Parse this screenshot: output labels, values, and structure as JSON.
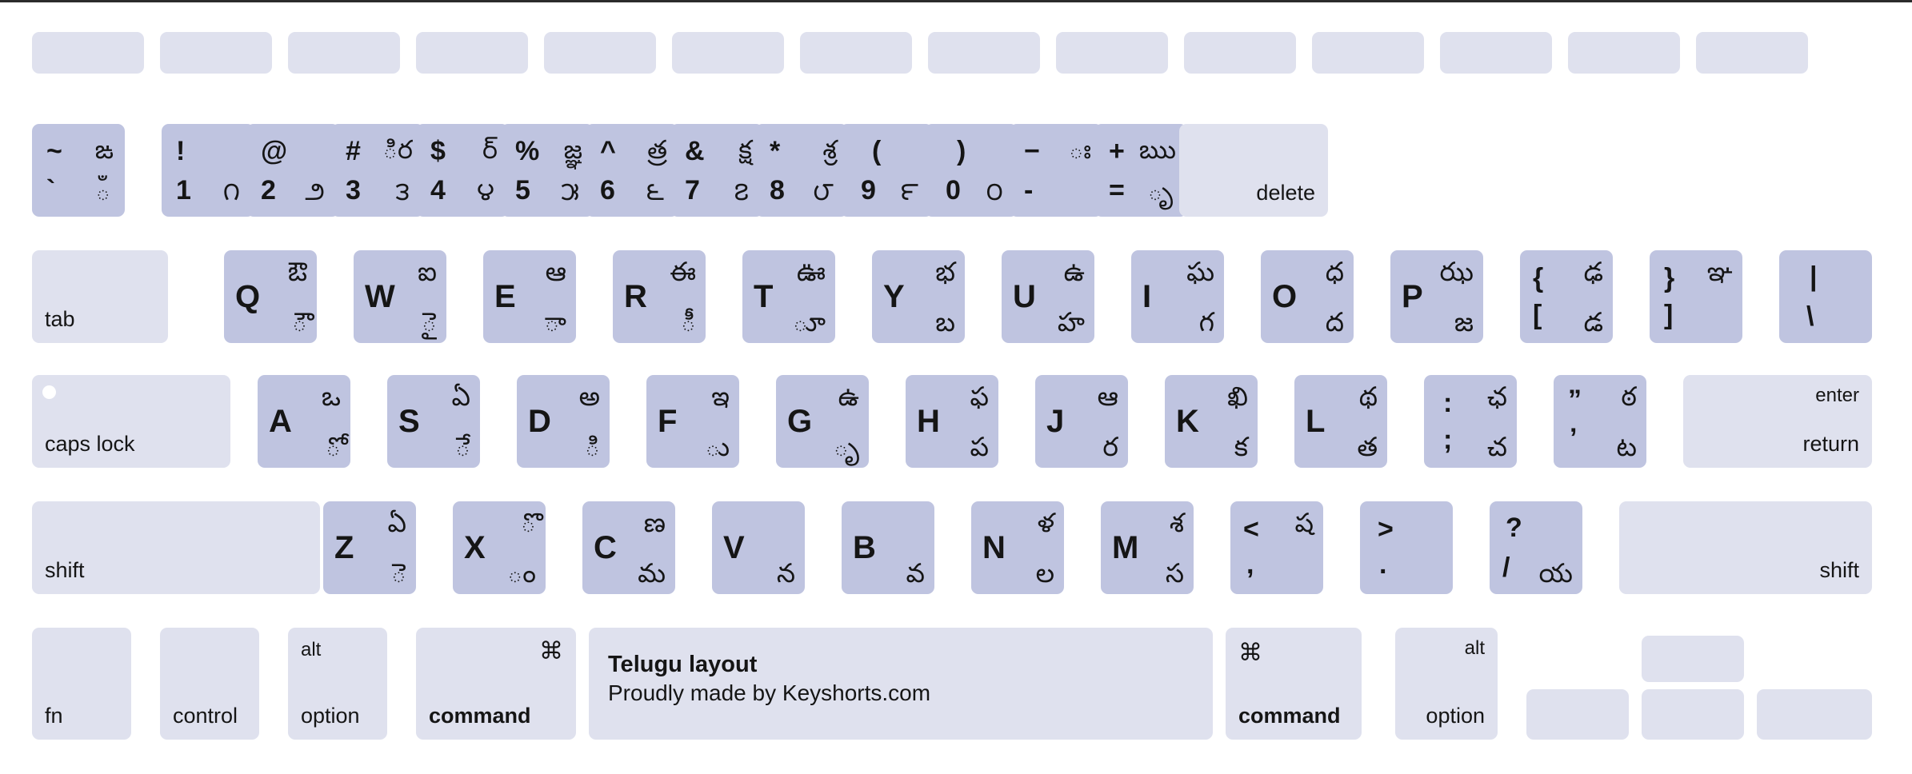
{
  "meta": {
    "layout_name": "Telugu layout",
    "colors": {
      "key_modifier": "#dfe1ee",
      "key_alpha": "#bfc4e0",
      "text": "#151515",
      "background": "#ffffff"
    }
  },
  "brand": {
    "title": "Telugu layout",
    "subtitle": "Proudly made by Keyshorts.com"
  },
  "rows": {
    "function_row": [
      {
        "name": "key-esc",
        "label": ""
      },
      {
        "name": "key-f1",
        "label": ""
      },
      {
        "name": "key-f2",
        "label": ""
      },
      {
        "name": "key-f3",
        "label": ""
      },
      {
        "name": "key-f4",
        "label": ""
      },
      {
        "name": "key-f5",
        "label": ""
      },
      {
        "name": "key-f6",
        "label": ""
      },
      {
        "name": "key-f7",
        "label": ""
      },
      {
        "name": "key-f8",
        "label": ""
      },
      {
        "name": "key-f9",
        "label": ""
      },
      {
        "name": "key-f10",
        "label": ""
      },
      {
        "name": "key-f11",
        "label": ""
      },
      {
        "name": "key-f12",
        "label": ""
      },
      {
        "name": "key-power",
        "label": ""
      }
    ],
    "number_row": [
      {
        "name": "key-grave",
        "sym_top": "~",
        "sym_bot": "`",
        "tel_top": "ఙ",
        "tel_bot": "ఀ"
      },
      {
        "name": "key-1",
        "sym_top": "!",
        "sym_bot": "1",
        "tel_top": "",
        "tel_bot": "౧"
      },
      {
        "name": "key-2",
        "sym_top": "@",
        "sym_bot": "2",
        "tel_top": "",
        "tel_bot": "౨"
      },
      {
        "name": "key-3",
        "sym_top": "#",
        "sym_bot": "3",
        "tel_top": "ిర",
        "tel_bot": "౩"
      },
      {
        "name": "key-4",
        "sym_top": "$",
        "sym_bot": "4",
        "tel_top": "ర్",
        "tel_bot": "౪"
      },
      {
        "name": "key-5",
        "sym_top": "%",
        "sym_bot": "5",
        "tel_top": "జ్ఞ",
        "tel_bot": "౫"
      },
      {
        "name": "key-6",
        "sym_top": "^",
        "sym_bot": "6",
        "tel_top": "త్ర",
        "tel_bot": "౬"
      },
      {
        "name": "key-7",
        "sym_top": "&",
        "sym_bot": "7",
        "tel_top": "క్ష",
        "tel_bot": "౭"
      },
      {
        "name": "key-8",
        "sym_top": "*",
        "sym_bot": "8",
        "tel_top": "శ్ర",
        "tel_bot": "౮"
      },
      {
        "name": "key-9",
        "sym_top": "(",
        "sym_bot": "9",
        "tel_top": "",
        "tel_bot": "౯"
      },
      {
        "name": "key-0",
        "sym_top": ")",
        "sym_bot": "0",
        "tel_top": "",
        "tel_bot": "౦"
      },
      {
        "name": "key-minus",
        "sym_top": "−",
        "sym_bot": "-",
        "tel_top": "ః",
        "tel_bot": ""
      },
      {
        "name": "key-equal",
        "sym_top": "+",
        "sym_bot": "=",
        "tel_top": "ఋ",
        "tel_bot": "ృ"
      },
      {
        "name": "key-delete",
        "label": "delete"
      }
    ],
    "top_row": [
      {
        "name": "key-tab",
        "label": "tab"
      },
      {
        "name": "key-q",
        "latin": "Q",
        "tel_top": "ఔ",
        "tel_bot": "ౌ"
      },
      {
        "name": "key-w",
        "latin": "W",
        "tel_top": "ఐ",
        "tel_bot": "ై"
      },
      {
        "name": "key-e",
        "latin": "E",
        "tel_top": "ఆ",
        "tel_bot": "ా"
      },
      {
        "name": "key-r",
        "latin": "R",
        "tel_top": "ఈ",
        "tel_bot": "ీ"
      },
      {
        "name": "key-t",
        "latin": "T",
        "tel_top": "ఊ",
        "tel_bot": "ూ"
      },
      {
        "name": "key-y",
        "latin": "Y",
        "tel_top": "భ",
        "tel_bot": "బ"
      },
      {
        "name": "key-u",
        "latin": "U",
        "tel_top": "ఉ",
        "tel_bot": "హ"
      },
      {
        "name": "key-i",
        "latin": "I",
        "tel_top": "ఘ",
        "tel_bot": "గ"
      },
      {
        "name": "key-o",
        "latin": "O",
        "tel_top": "ధ",
        "tel_bot": "ద"
      },
      {
        "name": "key-p",
        "latin": "P",
        "tel_top": "ఝ",
        "tel_bot": "జ"
      },
      {
        "name": "key-bracketleft",
        "sym_top": "{",
        "sym_bot": "[",
        "tel_top": "ఢ",
        "tel_bot": "డ"
      },
      {
        "name": "key-bracketright",
        "sym_top": "}",
        "sym_bot": "]",
        "tel_top": "ఞ",
        "tel_bot": ""
      },
      {
        "name": "key-backslash",
        "sym_top": "|",
        "sym_bot": "\\",
        "tel_top": "",
        "tel_bot": ""
      }
    ],
    "home_row": [
      {
        "name": "key-capslock",
        "label": "caps lock"
      },
      {
        "name": "key-a",
        "latin": "A",
        "tel_top": "ఒ",
        "tel_bot": "ో"
      },
      {
        "name": "key-s",
        "latin": "S",
        "tel_top": "ఏ",
        "tel_bot": "ే"
      },
      {
        "name": "key-d",
        "latin": "D",
        "tel_top": "అ",
        "tel_bot": "ి"
      },
      {
        "name": "key-f",
        "latin": "F",
        "tel_top": "ఇ",
        "tel_bot": "ు"
      },
      {
        "name": "key-g",
        "latin": "G",
        "tel_top": "ఉ",
        "tel_bot": "ృ"
      },
      {
        "name": "key-h",
        "latin": "H",
        "tel_top": "ఫ",
        "tel_bot": "ప"
      },
      {
        "name": "key-j",
        "latin": "J",
        "tel_top": "ఆ",
        "tel_bot": "ర"
      },
      {
        "name": "key-k",
        "latin": "K",
        "tel_top": "ఖి",
        "tel_bot": "క"
      },
      {
        "name": "key-l",
        "latin": "L",
        "tel_top": "థ",
        "tel_bot": "త"
      },
      {
        "name": "key-semicolon",
        "sym_top": ":",
        "sym_bot": ";",
        "tel_top": "ఛ",
        "tel_bot": "చ"
      },
      {
        "name": "key-quote",
        "sym_top": "”",
        "sym_bot": "’",
        "tel_top": "ఠ",
        "tel_bot": "ట"
      },
      {
        "name": "key-return",
        "label_top": "enter",
        "label_bottom": "return"
      }
    ],
    "bottom_letter_row": [
      {
        "name": "key-shift-left",
        "label": "shift"
      },
      {
        "name": "key-z",
        "latin": "Z",
        "tel_top": "ఏ",
        "tel_bot": "ె"
      },
      {
        "name": "key-x",
        "latin": "X",
        "tel_top": "ొ",
        "tel_bot": "ం"
      },
      {
        "name": "key-c",
        "latin": "C",
        "tel_top": "ణ",
        "tel_bot": "మ"
      },
      {
        "name": "key-v",
        "latin": "V",
        "tel_top": "",
        "tel_bot": "న"
      },
      {
        "name": "key-b",
        "latin": "B",
        "tel_top": "",
        "tel_bot": "వ"
      },
      {
        "name": "key-n",
        "latin": "N",
        "tel_top": "ళ",
        "tel_bot": "ల"
      },
      {
        "name": "key-m",
        "latin": "M",
        "tel_top": "శ",
        "tel_bot": "స"
      },
      {
        "name": "key-comma",
        "sym_top": "<",
        "sym_bot": ",",
        "tel_top": "ష",
        "tel_bot": ""
      },
      {
        "name": "key-period",
        "sym_top": ">",
        "sym_bot": ".",
        "tel_top": "",
        "tel_bot": ""
      },
      {
        "name": "key-slash",
        "sym_top": "?",
        "sym_bot": "/",
        "tel_top": "",
        "tel_bot": "య"
      },
      {
        "name": "key-shift-right",
        "label": "shift"
      }
    ],
    "modifier_row": [
      {
        "name": "key-fn",
        "label_bottom": "fn",
        "label_top": ""
      },
      {
        "name": "key-control",
        "label_bottom": "control",
        "label_top": ""
      },
      {
        "name": "key-option-left",
        "label_bottom": "option",
        "label_top": "alt"
      },
      {
        "name": "key-command-left",
        "label_bottom": "command",
        "label_top": "⌘"
      },
      {
        "name": "key-space",
        "label_bottom": "",
        "label_top": ""
      },
      {
        "name": "key-command-right",
        "label_bottom": "command",
        "label_top": "⌘"
      },
      {
        "name": "key-option-right",
        "label_bottom": "option",
        "label_top": "alt"
      },
      {
        "name": "key-arrow-left",
        "label_bottom": "",
        "label_top": ""
      },
      {
        "name": "key-arrow-up",
        "label_bottom": "",
        "label_top": ""
      },
      {
        "name": "key-arrow-down",
        "label_bottom": "",
        "label_top": ""
      },
      {
        "name": "key-arrow-right",
        "label_bottom": "",
        "label_top": ""
      }
    ]
  }
}
